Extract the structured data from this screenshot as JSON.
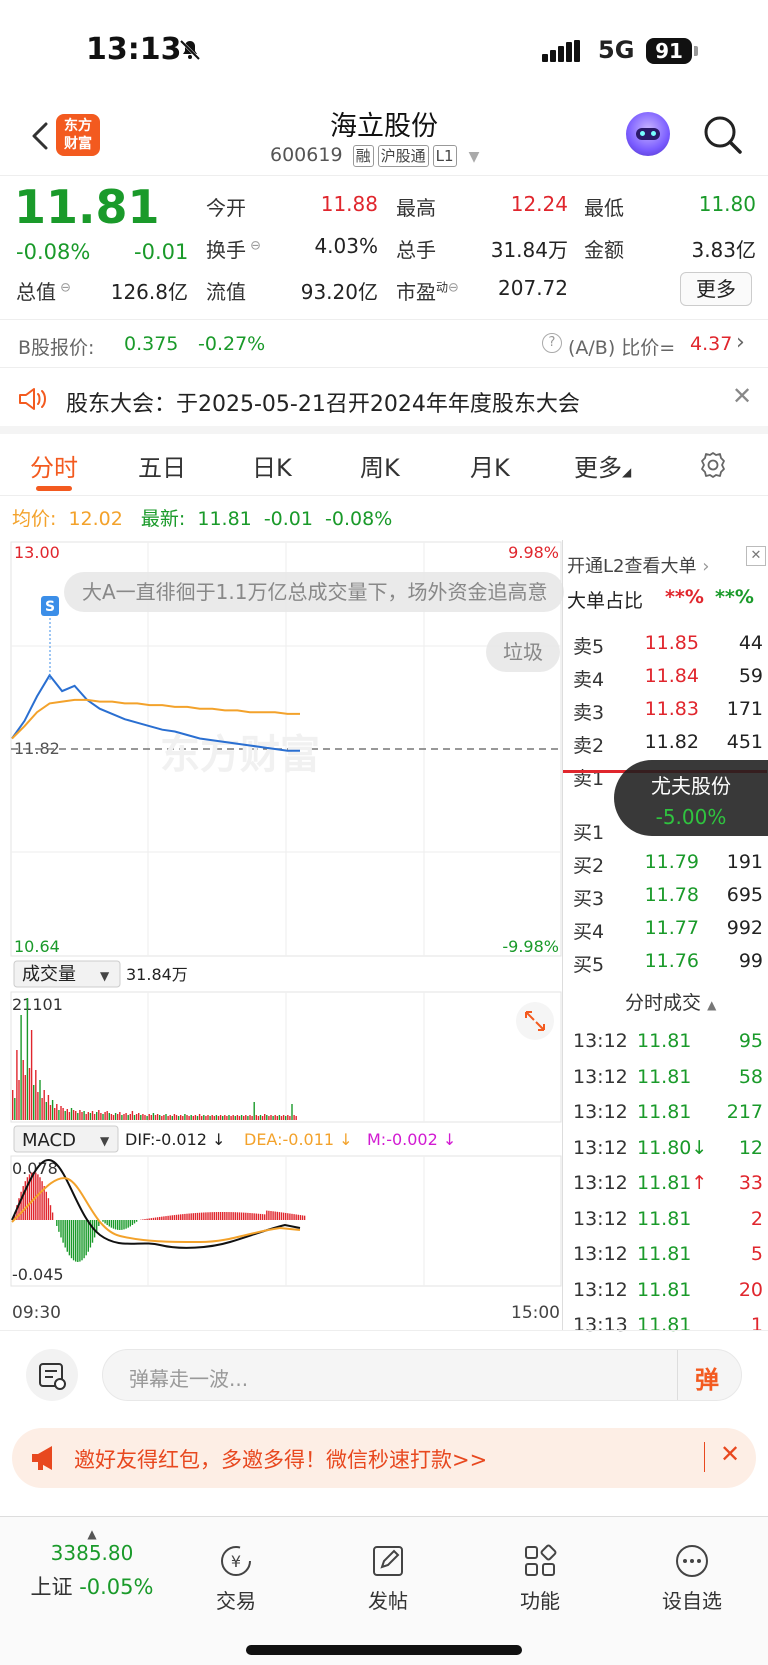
{
  "status_bar": {
    "time": "13:13",
    "network": "5G",
    "battery": "91"
  },
  "header": {
    "logo_text_1": "东方",
    "logo_text_2": "财富",
    "title": "海立股份",
    "code": "600619",
    "tags": [
      "融",
      "沪股通",
      "L1"
    ]
  },
  "quote": {
    "price": "11.81",
    "change_pct": "-0.08%",
    "change": "-0.01",
    "fields": [
      {
        "label": "今开",
        "value": "11.88",
        "color": "red"
      },
      {
        "label": "最高",
        "value": "12.24",
        "color": "red"
      },
      {
        "label": "最低",
        "value": "11.80",
        "color": "green"
      },
      {
        "label": "换手",
        "value": "4.03%",
        "color": "black"
      },
      {
        "label": "总手",
        "value": "31.84万",
        "color": "black"
      },
      {
        "label": "金额",
        "value": "3.83亿",
        "color": "black"
      },
      {
        "label": "总值",
        "value": "126.8亿",
        "color": "black"
      },
      {
        "label": "流值",
        "value": "93.20亿",
        "color": "black"
      },
      {
        "label": "市盈",
        "value": "207.72",
        "color": "black"
      }
    ],
    "pe_superscript": "动",
    "more_label": "更多"
  },
  "b_share": {
    "label": "B股报价:",
    "price": "0.375",
    "change": "-0.27%",
    "ratio_label": "(A/B) 比价=",
    "ratio_value": "4.37"
  },
  "notice": {
    "text": "股东大会：于2025-05-21召开2024年年度股东大会"
  },
  "tabs": [
    "分时",
    "五日",
    "日K",
    "周K",
    "月K",
    "更多"
  ],
  "avg_line": {
    "avg_label": "均价:",
    "avg_value": "12.02",
    "latest_label": "最新:",
    "latest_value": "11.81",
    "latest_change": "-0.01",
    "latest_pct": "-0.08%"
  },
  "chart_data": {
    "type": "line",
    "price_axis": {
      "max": "13.00",
      "min": "10.64",
      "prev_close": "11.82",
      "max_pct": "9.98%",
      "min_pct": "-9.98%"
    },
    "time_axis": {
      "start": "09:30",
      "end": "15:00"
    },
    "series": [
      {
        "name": "price",
        "values": [
          11.88,
          11.98,
          12.12,
          12.24,
          12.15,
          12.18,
          12.1,
          12.05,
          12.02,
          11.99,
          11.97,
          11.95,
          11.93,
          11.92,
          11.9,
          11.88,
          11.87,
          11.86,
          11.85,
          11.84,
          11.83,
          11.82,
          11.81,
          11.81
        ]
      },
      {
        "name": "avg",
        "values": [
          11.88,
          11.95,
          12.03,
          12.08,
          12.09,
          12.1,
          12.1,
          12.09,
          12.09,
          12.08,
          12.08,
          12.07,
          12.07,
          12.06,
          12.06,
          12.05,
          12.05,
          12.04,
          12.04,
          12.03,
          12.03,
          12.03,
          12.02,
          12.02
        ]
      }
    ],
    "volume_label": "成交量",
    "volume_total": "31.84万",
    "volume_max": "21101",
    "macd": {
      "label": "MACD",
      "dif": "DIF:-0.012 ↓",
      "dea": "DEA:-0.011 ↓",
      "m": "M:-0.002 ↓",
      "max": "0.078",
      "min": "-0.045"
    }
  },
  "danmu": {
    "text": "大A一直徘徊于1.1万亿总成交量下，场外资金追高意",
    "trash": "垃圾"
  },
  "watermark": "东方财富",
  "order_book": {
    "l2_link": "开通L2查看大单",
    "big_order_label": "大单占比",
    "big_red": "**%",
    "big_green": "**%",
    "asks": [
      {
        "label": "卖5",
        "price": "11.85",
        "vol": "44",
        "color": "red"
      },
      {
        "label": "卖4",
        "price": "11.84",
        "vol": "59",
        "color": "red"
      },
      {
        "label": "卖3",
        "price": "11.83",
        "vol": "171",
        "color": "red"
      },
      {
        "label": "卖2",
        "price": "11.82",
        "vol": "451",
        "color": "black"
      },
      {
        "label": "卖1",
        "price": "",
        "vol": "",
        "color": "black"
      }
    ],
    "bids": [
      {
        "label": "买1",
        "price": "",
        "vol": "",
        "color": "green"
      },
      {
        "label": "买2",
        "price": "11.79",
        "vol": "191",
        "color": "green"
      },
      {
        "label": "买3",
        "price": "11.78",
        "vol": "695",
        "color": "green"
      },
      {
        "label": "买4",
        "price": "11.77",
        "vol": "992",
        "color": "green"
      },
      {
        "label": "买5",
        "price": "11.76",
        "vol": "99",
        "color": "green"
      }
    ],
    "trades_label": "分时成交",
    "trades": [
      {
        "time": "13:12",
        "price": "11.81",
        "vol": "95",
        "arrow": ""
      },
      {
        "time": "13:12",
        "price": "11.81",
        "vol": "58",
        "arrow": ""
      },
      {
        "time": "13:12",
        "price": "11.81",
        "vol": "217",
        "arrow": ""
      },
      {
        "time": "13:12",
        "price": "11.80",
        "vol": "12",
        "arrow": "↓"
      },
      {
        "time": "13:12",
        "price": "11.81",
        "vol": "33",
        "arrow": "↑"
      },
      {
        "time": "13:12",
        "price": "11.81",
        "vol": "2",
        "arrow": ""
      },
      {
        "time": "13:12",
        "price": "11.81",
        "vol": "5",
        "arrow": ""
      },
      {
        "time": "13:12",
        "price": "11.81",
        "vol": "20",
        "arrow": ""
      },
      {
        "time": "13:13",
        "price": "11.81",
        "vol": "1",
        "arrow": ""
      }
    ]
  },
  "popup": {
    "name": "尤夫股份",
    "pct": "-5.00%"
  },
  "comment": {
    "placeholder": "弹幕走一波...",
    "danmu_btn": "弹"
  },
  "banner": {
    "text": "邀好友得红包，多邀多得！微信秒速打款>>"
  },
  "bottom_nav": {
    "index_value": "3385.80",
    "index_name": "上证",
    "index_pct": "-0.05%",
    "items": [
      "交易",
      "发帖",
      "功能",
      "设自选"
    ]
  }
}
